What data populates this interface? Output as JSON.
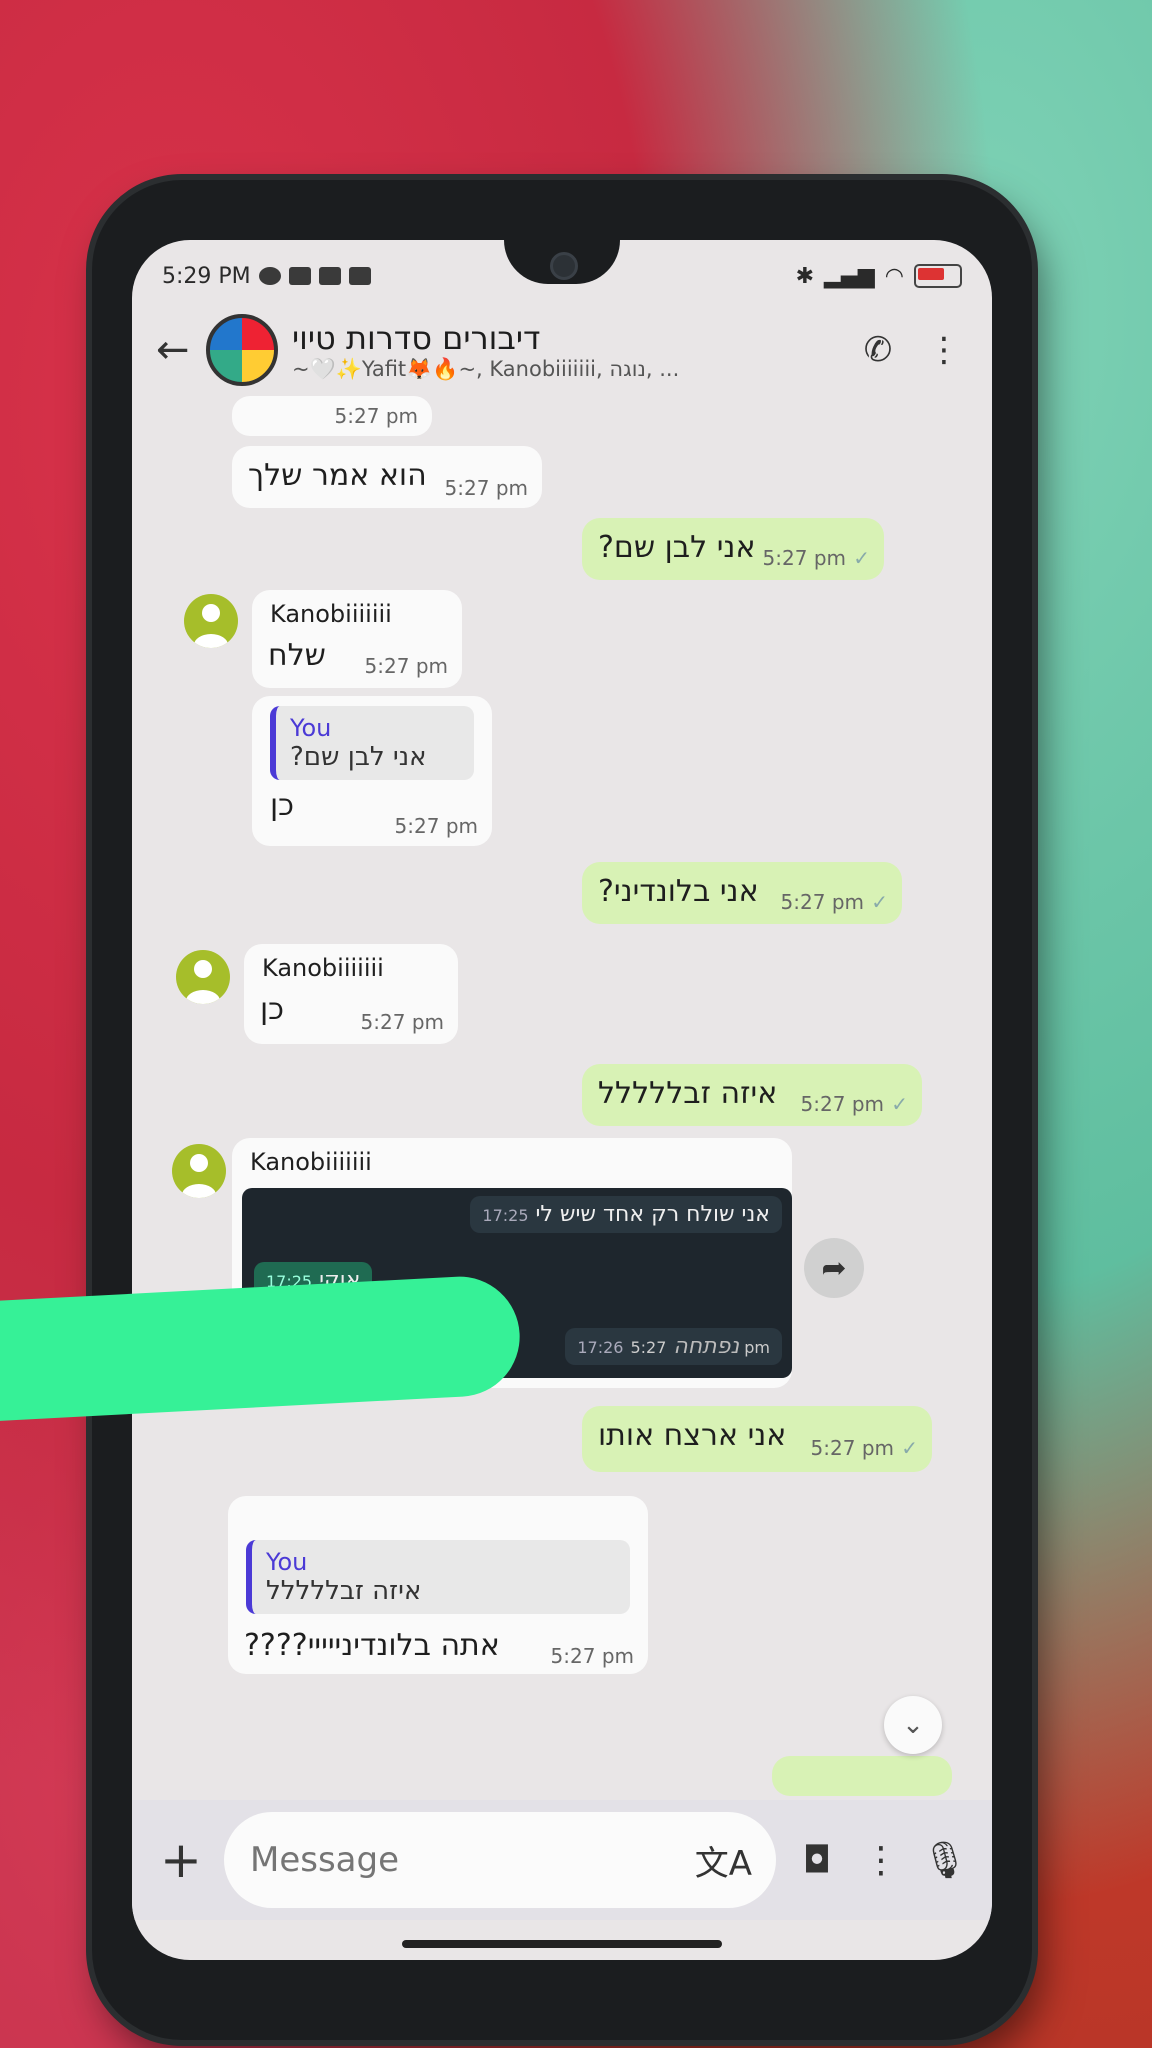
{
  "status_bar": {
    "time": "5:29 PM"
  },
  "header": {
    "back_icon": "arrow-left-icon",
    "title": "דיבורים סדרות טיוי",
    "subtitle": "~🤍✨Yafit🦊🔥~, Kanobiiiiiii, נוגה, ..."
  },
  "messages": [
    {
      "time": "5:27 pm"
    },
    {
      "text": "הוא אמר שלך",
      "time": "5:27 pm"
    },
    {
      "text": "אני לבן שם?",
      "time": "5:27 pm",
      "tick": "✓"
    },
    {
      "sender": "Kanobiiiiiii",
      "text": "שלח",
      "time": "5:27 pm"
    },
    {
      "quote_name": "You",
      "quote_text": "אני לבן שם?",
      "text": "כן",
      "time": "5:27 pm"
    },
    {
      "text": "אני בלונדיני?",
      "time": "5:27 pm",
      "tick": "✓"
    },
    {
      "sender": "Kanobiiiiiii",
      "text": "כן",
      "time": "5:27 pm"
    },
    {
      "text": "איזה זבללללל",
      "time": "5:27 pm",
      "tick": "✓"
    },
    {
      "sender": "Kanobiiiiiii",
      "embed": {
        "line1": "אני שולח רק אחד שיש לי",
        "line1_time": "17:25",
        "line2": "אוקי",
        "line2_time": "17:25",
        "line3": "נפתחה",
        "line3_time": "17:26",
        "overlay_time": "5:27 pm"
      }
    },
    {
      "text": "אני ארצח אותו",
      "time": "5:27 pm",
      "tick": "✓"
    },
    {
      "quote_name": "You",
      "quote_text": "איזה זבללללל",
      "text": "אתה בלונדינייייי????",
      "time": "5:27 pm"
    }
  ],
  "input": {
    "placeholder": "Message"
  },
  "colors": {
    "outgoing": "#d8f2b5",
    "incoming": "#fafafa",
    "quote_accent": "#4b3ad6",
    "avatar": "#a6be2a",
    "scribble": "#36f197"
  }
}
